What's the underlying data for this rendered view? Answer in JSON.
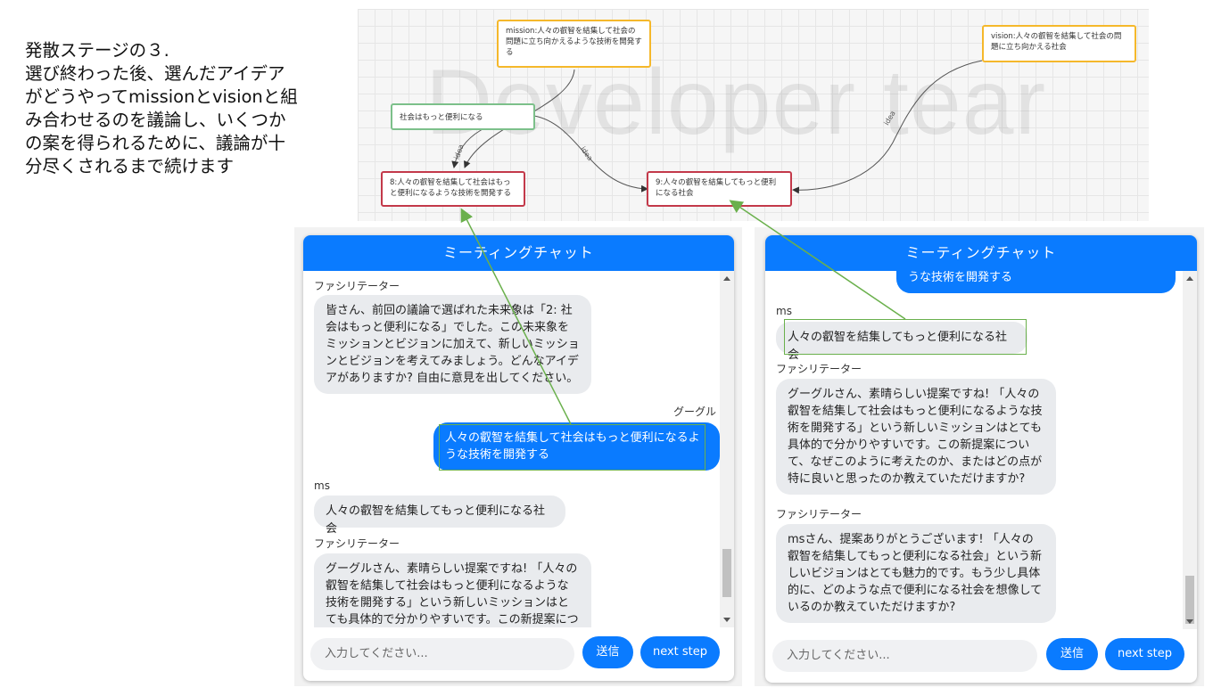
{
  "description": {
    "lines": [
      "発散ステージの３.",
      "選び終わった後、選んだアイデア",
      "がどうやってmissionとvisionと組",
      "み合わせるのを議論し、いくつか",
      "の案を得られるために、議論が十",
      "分尽くされるまで続けます"
    ]
  },
  "diagram": {
    "watermark": "Developer tear",
    "nodes": {
      "mission": "mission:人々の叡智を結集して社会の問題に立ち向かえるような技術を開発する",
      "vision": "vision:人々の叡智を結集して社会の問題に立ち向かえる社会",
      "idea_source": "社会はもっと便利になる",
      "node8": "8:人々の叡智を結集して社会はもっと便利になるような技術を開発する",
      "node9": "9:人々の叡智を結集してもっと便利になる社会"
    },
    "edge_label": "idea"
  },
  "chat_left": {
    "header": "ミーティングチャット",
    "messages": [
      {
        "sender": "ファシリテーター",
        "text": "皆さん、前回の議論で選ばれた未来象は「2: 社会はもっと便利になる」でした。この未来象をミッションとビジョンに加えて、新しいミッションとビジョンを考えてみましょう。どんなアイデアがありますか? 自由に意見を出してください。"
      },
      {
        "sender": "グーグル",
        "text": "人々の叡智を結集して社会はもっと便利になるような技術を開発する"
      },
      {
        "sender": "ms",
        "text": "人々の叡智を結集してもっと便利になる社会"
      },
      {
        "sender": "ファシリテーター",
        "text": "グーグルさん、素晴らしい提案ですね! 「人々の叡智を結集して社会はもっと便利になるような技術を開発する」という新しいミッションはとても具体的で分かりやすいです。この新提案について、なぜこのように考えたのか、またはどの点が特に良いと思ったのか教えていただけますか?"
      }
    ],
    "input_placeholder": "入力してください...",
    "send_label": "送信",
    "next_label": "next step"
  },
  "chat_right": {
    "header": "ミーティングチャット",
    "messages": [
      {
        "sender": "",
        "text": "うな技術を開発する"
      },
      {
        "sender": "ms",
        "text": "人々の叡智を結集してもっと便利になる社会"
      },
      {
        "sender": "ファシリテーター",
        "text": "グーグルさん、素晴らしい提案ですね! 「人々の叡智を結集して社会はもっと便利になるような技術を開発する」という新しいミッションはとても具体的で分かりやすいです。この新提案について、なぜこのように考えたのか、またはどの点が特に良いと思ったのか教えていただけますか?"
      },
      {
        "sender": "ファシリテーター",
        "text": "msさん、提案ありがとうございます! 「人々の叡智を結集してもっと便利になる社会」という新しいビジョンはとても魅力的です。もう少し具体的に、どのような点で便利になる社会を想像しているのか教えていただけますか?"
      }
    ],
    "input_placeholder": "入力してください...",
    "send_label": "送信",
    "next_label": "next step"
  },
  "colors": {
    "accent": "#0a7bff",
    "highlight": "#6ab04c",
    "node_yellow": "#f5b82b",
    "node_green": "#7cc08a",
    "node_red": "#c3394a"
  }
}
